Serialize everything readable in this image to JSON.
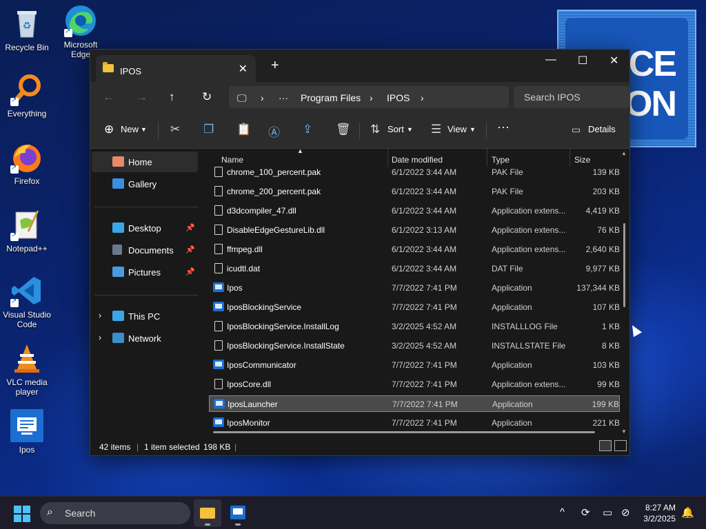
{
  "desktop": {
    "icons": [
      {
        "label": "Recycle Bin"
      },
      {
        "label": "Microsoft Edge"
      },
      {
        "label": "Everything"
      },
      {
        "label": "Firefox"
      },
      {
        "label": "Notepad++"
      },
      {
        "label": "Visual Studio Code"
      },
      {
        "label": "VLC media player"
      },
      {
        "label": "Ipos"
      }
    ],
    "promo_text": "RVICE\nATION"
  },
  "window": {
    "tab_title": "IPOS",
    "breadcrumb": [
      "Program Files",
      "IPOS"
    ],
    "search_placeholder": "Search IPOS",
    "toolbar": {
      "new": "New",
      "sort": "Sort",
      "view": "View",
      "details": "Details"
    },
    "nav": {
      "items": [
        {
          "label": "Home"
        },
        {
          "label": "Gallery"
        },
        {
          "label": "Desktop"
        },
        {
          "label": "Documents"
        },
        {
          "label": "Pictures"
        },
        {
          "label": "This PC"
        },
        {
          "label": "Network"
        }
      ]
    },
    "columns": {
      "name": "Name",
      "date": "Date modified",
      "type": "Type",
      "size": "Size"
    },
    "files": [
      {
        "name": "chrome_100_percent.pak",
        "date": "6/1/2022 3:44 AM",
        "type": "PAK File",
        "size": "139 KB",
        "icon": "file-icon"
      },
      {
        "name": "chrome_200_percent.pak",
        "date": "6/1/2022 3:44 AM",
        "type": "PAK File",
        "size": "203 KB",
        "icon": "file-icon"
      },
      {
        "name": "d3dcompiler_47.dll",
        "date": "6/1/2022 3:44 AM",
        "type": "Application extens...",
        "size": "4,419 KB",
        "icon": "dll-icon"
      },
      {
        "name": "DisableEdgeGestureLib.dll",
        "date": "6/1/2022 3:13 AM",
        "type": "Application extens...",
        "size": "76 KB",
        "icon": "dll-icon"
      },
      {
        "name": "ffmpeg.dll",
        "date": "6/1/2022 3:44 AM",
        "type": "Application extens...",
        "size": "2,640 KB",
        "icon": "dll-icon"
      },
      {
        "name": "icudtl.dat",
        "date": "6/1/2022 3:44 AM",
        "type": "DAT File",
        "size": "9,977 KB",
        "icon": "file-icon"
      },
      {
        "name": "Ipos",
        "date": "7/7/2022 7:41 PM",
        "type": "Application",
        "size": "137,344 KB",
        "icon": "app-icon"
      },
      {
        "name": "IposBlockingService",
        "date": "7/7/2022 7:41 PM",
        "type": "Application",
        "size": "107 KB",
        "icon": "app-icon"
      },
      {
        "name": "IposBlockingService.InstallLog",
        "date": "3/2/2025 4:52 AM",
        "type": "INSTALLLOG File",
        "size": "1 KB",
        "icon": "file-icon"
      },
      {
        "name": "IposBlockingService.InstallState",
        "date": "3/2/2025 4:52 AM",
        "type": "INSTALLSTATE File",
        "size": "8 KB",
        "icon": "file-icon"
      },
      {
        "name": "IposCommunicator",
        "date": "7/7/2022 7:41 PM",
        "type": "Application",
        "size": "103 KB",
        "icon": "app-icon"
      },
      {
        "name": "IposCore.dll",
        "date": "7/7/2022 7:41 PM",
        "type": "Application extens...",
        "size": "99 KB",
        "icon": "dll-icon"
      },
      {
        "name": "IposLauncher",
        "date": "7/7/2022 7:41 PM",
        "type": "Application",
        "size": "199 KB",
        "icon": "app-icon",
        "selected": true
      },
      {
        "name": "IposMonitor",
        "date": "7/7/2022 7:41 PM",
        "type": "Application",
        "size": "221 KB",
        "icon": "app-icon"
      }
    ],
    "status": {
      "items": "42 items",
      "selected": "1 item selected",
      "size": "198 KB"
    }
  },
  "taskbar": {
    "search_placeholder": "Search",
    "time": "8:27 AM",
    "date": "3/2/2025"
  },
  "colors": {
    "accent": "#4cc2ff",
    "folder": "#f3c13a",
    "app_blue": "#1b6fd0"
  }
}
